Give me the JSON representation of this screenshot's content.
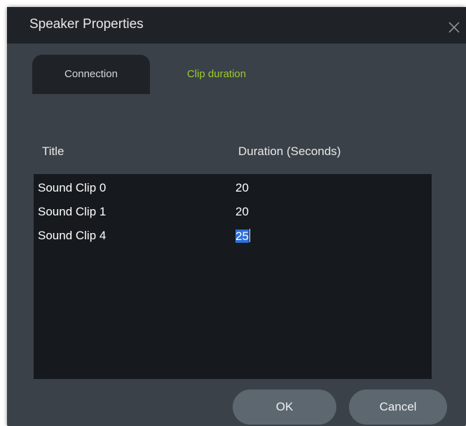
{
  "window": {
    "title": "Speaker Properties",
    "close_icon": "close-icon"
  },
  "tabs": [
    {
      "label": "Connection",
      "active": false
    },
    {
      "label": "Clip duration",
      "active": true
    }
  ],
  "table": {
    "columns": [
      "Title",
      "Duration (Seconds)"
    ],
    "rows": [
      {
        "title": "Sound Clip 0",
        "duration": "20"
      },
      {
        "title": "Sound Clip 1",
        "duration": "20"
      },
      {
        "title": "Sound Clip 4",
        "duration": "25",
        "editing": true
      }
    ]
  },
  "buttons": {
    "ok": "OK",
    "cancel": "Cancel"
  },
  "colors": {
    "active_tab_text": "#9ccc2c",
    "selection": "#2f6fd8",
    "dialog_bg": "#3a4148",
    "titlebar_bg": "#1f2328",
    "list_bg": "#161a1e",
    "button_bg": "#5d6770"
  }
}
